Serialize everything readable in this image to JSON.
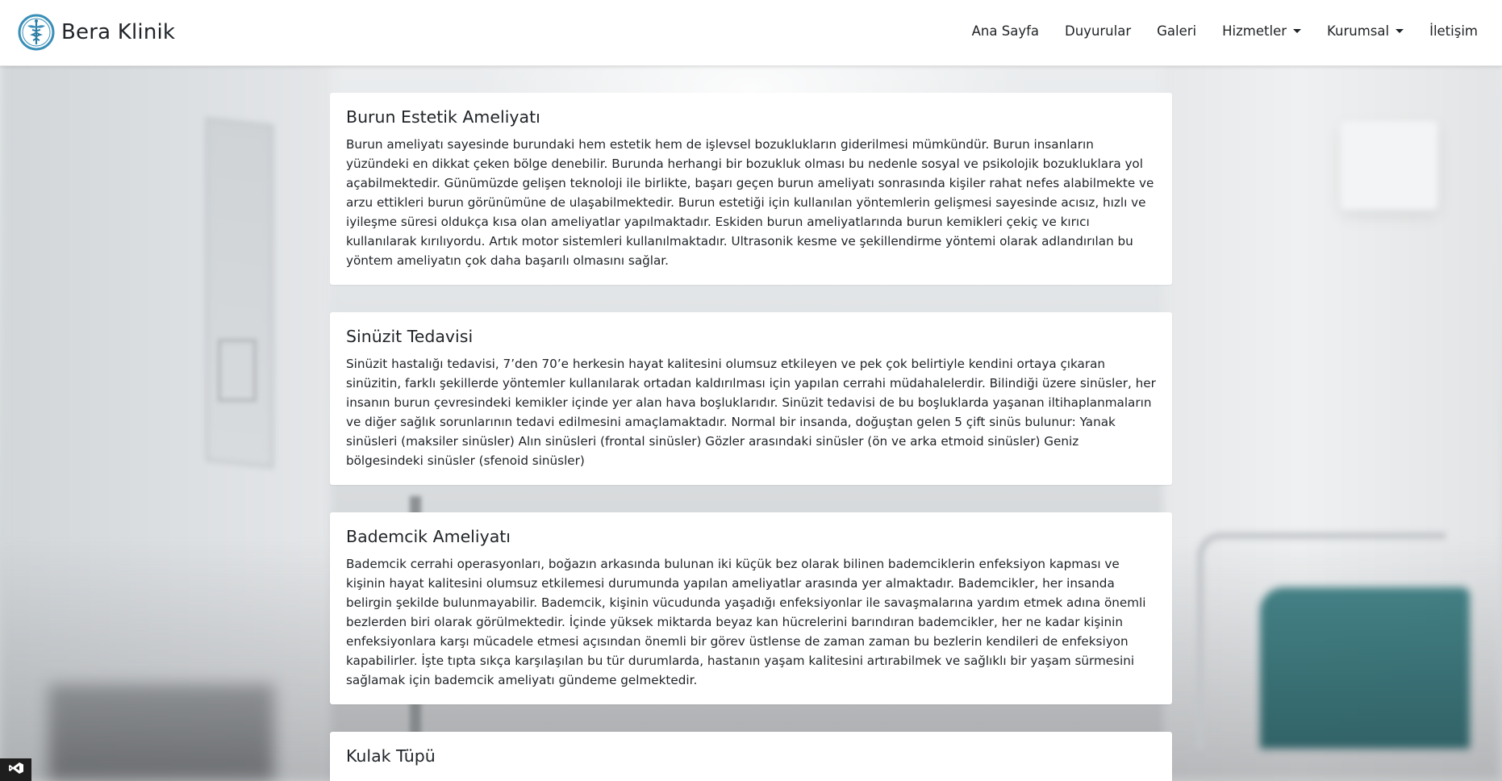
{
  "brand": {
    "name": "Bera Klinik",
    "logo_icon": "caduceus-icon",
    "accent": "#3a8fb7"
  },
  "nav": {
    "items": [
      {
        "label": "Ana Sayfa"
      },
      {
        "label": "Duyurular"
      },
      {
        "label": "Galeri"
      },
      {
        "label": "Hizmetler",
        "dropdown": true
      },
      {
        "label": "Kurumsal",
        "dropdown": true
      },
      {
        "label": "İletişim"
      }
    ]
  },
  "services": [
    {
      "title": "Burun Estetik Ameliyatı",
      "text": "Burun ameliyatı sayesinde burundaki hem estetik hem de işlevsel bozuklukların giderilmesi mümkündür. Burun insanların yüzündeki en dikkat çeken bölge denebilir. Burunda herhangi bir bozukluk olması bu nedenle sosyal ve psikolojik bozukluklara yol açabilmektedir. Günümüzde gelişen teknoloji ile birlikte, başarı geçen burun ameliyatı sonrasında kişiler rahat nefes alabilmekte ve arzu ettikleri burun görünümüne de ulaşabilmektedir. Burun estetiği için kullanılan yöntemlerin gelişmesi sayesinde acısız, hızlı ve iyileşme süresi oldukça kısa olan ameliyatlar yapılmaktadır. Eskiden burun ameliyatlarında burun kemikleri çekiç ve kırıcı kullanılarak kırılıyordu. Artık motor sistemleri kullanılmaktadır. Ultrasonik kesme ve şekillendirme yöntemi olarak adlandırılan bu yöntem ameliyatın çok daha başarılı olmasını sağlar."
    },
    {
      "title": "Sinüzit Tedavisi",
      "text": "Sinüzit hastalığı tedavisi, 7’den 70’e herkesin hayat kalitesini olumsuz etkileyen ve pek çok belirtiyle kendini ortaya çıkaran sinüzitin, farklı şekillerde yöntemler kullanılarak ortadan kaldırılması için yapılan cerrahi müdahalelerdir. Bilindiği üzere sinüsler, her insanın burun çevresindeki kemikler içinde yer alan hava boşluklarıdır. Sinüzit tedavisi de bu boşluklarda yaşanan iltihaplanmaların ve diğer sağlık sorunlarının tedavi edilmesini amaçlamaktadır. Normal bir insanda, doğuştan gelen 5 çift sinüs bulunur: Yanak sinüsleri (maksiler sinüsler) Alın sinüsleri (frontal sinüsler) Gözler arasındaki sinüsler (ön ve arka etmoid sinüsler) Geniz bölgesindeki sinüsler (sfenoid sinüsler)"
    },
    {
      "title": "Bademcik Ameliyatı",
      "text": "Bademcik cerrahi operasyonları, boğazın arkasında bulunan iki küçük bez olarak bilinen bademciklerin enfeksiyon kapması ve kişinin hayat kalitesini olumsuz etkilemesi durumunda yapılan ameliyatlar arasında yer almaktadır. Bademcikler, her insanda belirgin şekilde bulunmayabilir. Bademcik, kişinin vücudunda yaşadığı enfeksiyonlar ile savaşmalarına yardım etmek adına önemli bezlerden biri olarak görülmektedir. İçinde yüksek miktarda beyaz kan hücrelerini barındıran bademcikler, her ne kadar kişinin enfeksiyonlara karşı mücadele etmesi açısından önemli bir görev üstlense de zaman zaman bu bezlerin kendileri de enfeksiyon kapabilirler. İşte tıpta sıkça karşılaşılan bu tür durumlarda, hastanın yaşam kalitesini artırabilmek ve sağlıklı bir yaşam sürmesini sağlamak için bademcik ameliyatı gündeme gelmektedir."
    },
    {
      "title": "Kulak Tüpü",
      "text": ""
    }
  ],
  "badge": {
    "icon": "visual-studio-icon"
  }
}
